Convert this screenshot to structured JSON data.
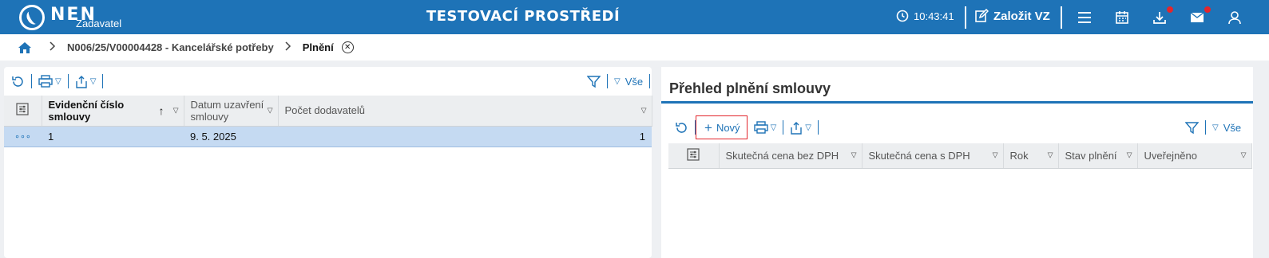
{
  "header": {
    "logo_text": "NEN",
    "logo_sub": "Zadavatel",
    "env_title": "TESTOVACÍ PROSTŘEDÍ",
    "clock": "10:43:41",
    "create_label": "Založit VZ",
    "icons": [
      "menu-icon",
      "calendar-icon",
      "download-icon",
      "mail-icon",
      "user-icon"
    ]
  },
  "breadcrumb": {
    "items": [
      "N006/25/V00004428 - Kancelářské potřeby"
    ],
    "current": "Plnění"
  },
  "left": {
    "filter_all": "Vše",
    "columns": [
      {
        "label": "Evidenční číslo smlouvy"
      },
      {
        "label": "Datum uzavření smlouvy"
      },
      {
        "label": "Počet dodavatelů"
      }
    ],
    "rows": [
      {
        "number": "1",
        "date": "9. 5. 2025",
        "count": "1"
      }
    ]
  },
  "right": {
    "title": "Přehled plnění smlouvy",
    "new_label": "Nový",
    "filter_all": "Vše",
    "columns": [
      {
        "label": "Skutečná cena bez DPH"
      },
      {
        "label": "Skutečná cena s DPH"
      },
      {
        "label": "Rok"
      },
      {
        "label": "Stav plnění"
      },
      {
        "label": "Uveřejněno"
      }
    ]
  },
  "colors": {
    "brand": "#1e73b7",
    "selected_row": "#c5daf2",
    "highlight": "#e3262c"
  }
}
